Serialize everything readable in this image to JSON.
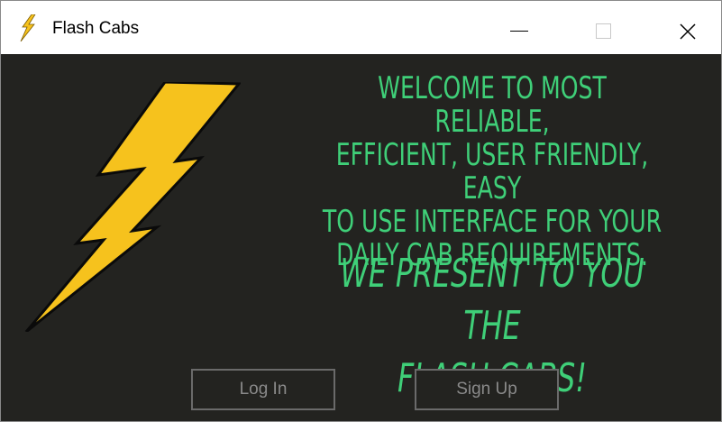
{
  "window": {
    "title": "Flash Cabs",
    "icon": "lightning-bolt-icon",
    "controls": [
      "minimize-icon",
      "maximize-icon",
      "close-icon"
    ]
  },
  "welcome_lines": [
    "WELCOME TO MOST RELIABLE,",
    "EFFICIENT, USER FRIENDLY, EASY",
    "TO USE INTERFACE FOR YOUR",
    "DAILY CAB REQUIREMENTS."
  ],
  "present_lines": [
    "WE PRESENT TO YOU THE",
    "FLASH CABS!"
  ],
  "buttons": {
    "login": "Log In",
    "signup": "Sign Up"
  },
  "colors": {
    "background": "#232320",
    "accent_text": "#3fcf78",
    "bolt_fill": "#f6c21d",
    "button_border": "#6a6a6a",
    "button_text": "#8a8a8a"
  }
}
